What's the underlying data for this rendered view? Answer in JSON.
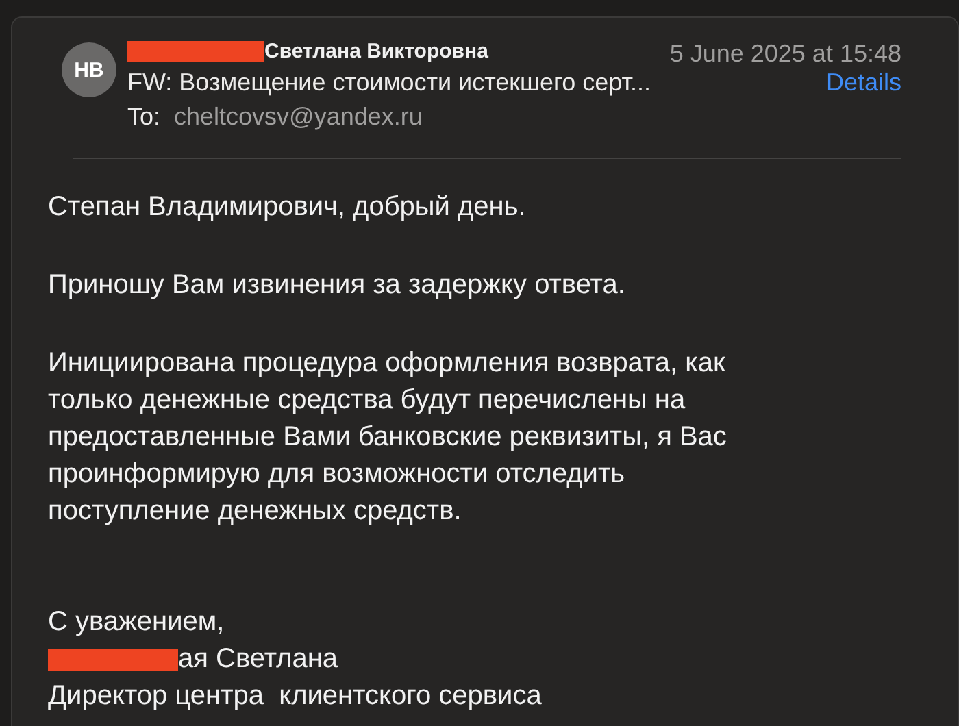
{
  "message": {
    "avatar": "НВ",
    "sender": {
      "name": "Светлана Викторовна",
      "redacted": true
    },
    "date": "5 June 2025 at 15:48",
    "subject": "FW: Возмещение стоимости истекшего серт...",
    "details_link": "Details",
    "to_label": "To:",
    "to": "cheltcovsv@yandex.ru"
  },
  "body": [
    {
      "lines": [
        "Степан Владимирович, добрый день."
      ]
    },
    {
      "lines": [
        "Приношу Вам извинения за задержку ответа."
      ]
    },
    {
      "lines": [
        "Инициирована процедура оформления возврата, как",
        "только денежные средства будут перечислены на",
        "предоставленные Вами банковские реквизиты, я Вас",
        "проинформирую для возможности отследить",
        "поступление денежных средств."
      ]
    }
  ],
  "signature": [
    {
      "text": "С уважением,",
      "redacted": false
    },
    {
      "text": "ая Светлана",
      "redacted": true
    },
    {
      "text": "Директор центра  клиентского сервиса",
      "redacted": false
    }
  ]
}
